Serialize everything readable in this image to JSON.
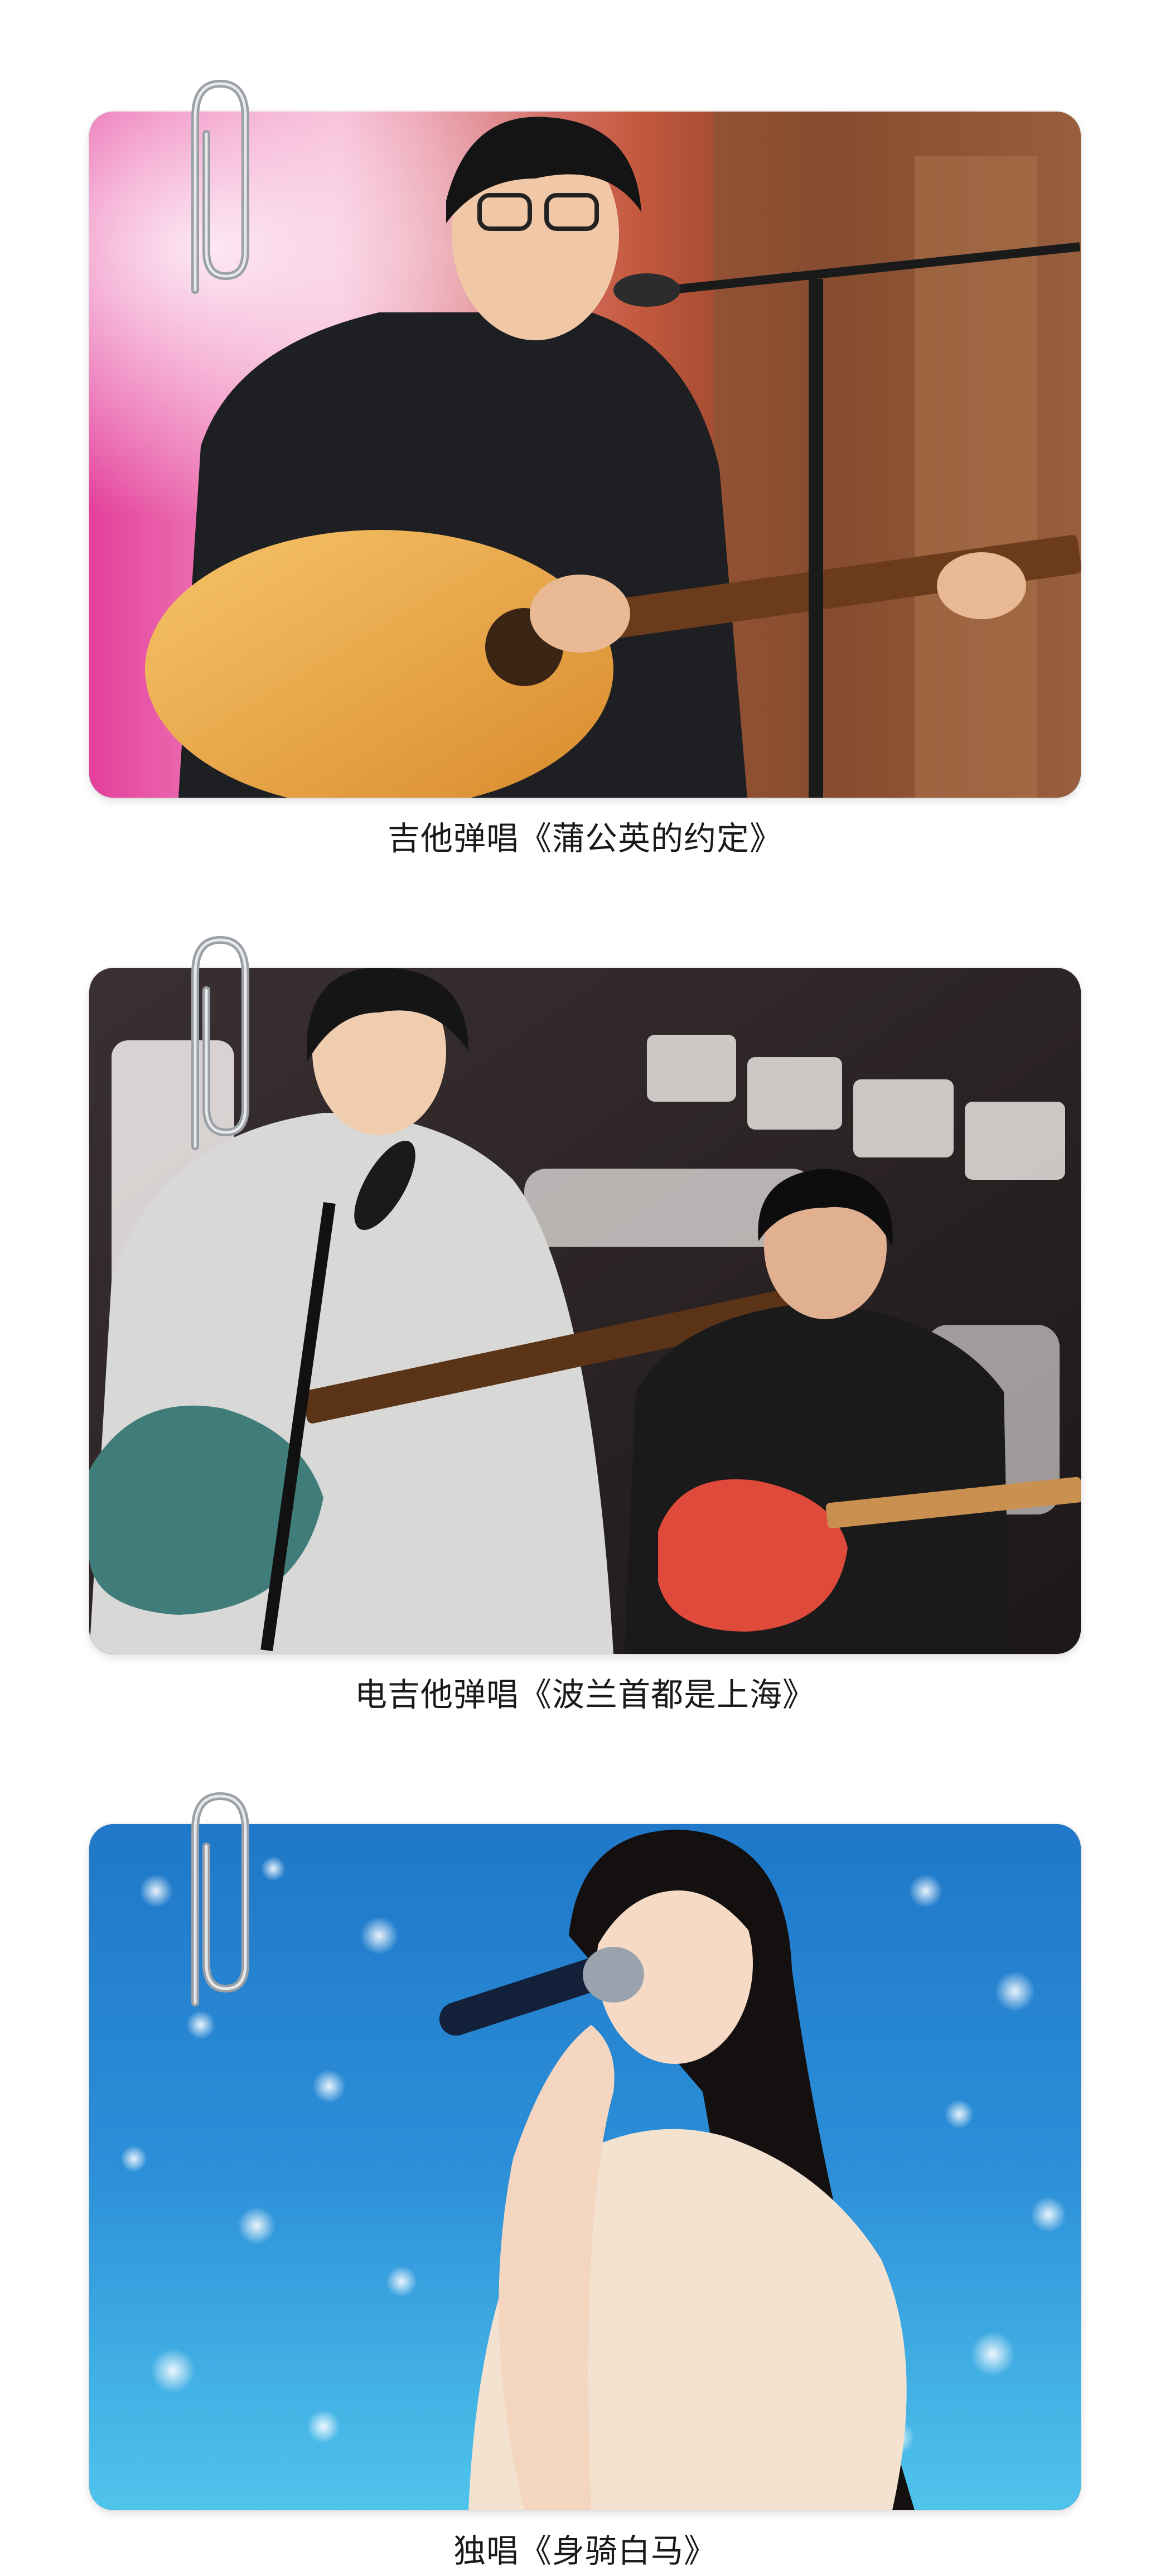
{
  "photos": [
    {
      "caption": "吉他弹唱《蒲公英的约定》",
      "scene": "acoustic-guitar-singer"
    },
    {
      "caption": "电吉他弹唱《波兰首都是上海》",
      "scene": "electric-guitar-duo"
    },
    {
      "caption": "独唱《身骑白马》",
      "scene": "solo-singer"
    }
  ]
}
